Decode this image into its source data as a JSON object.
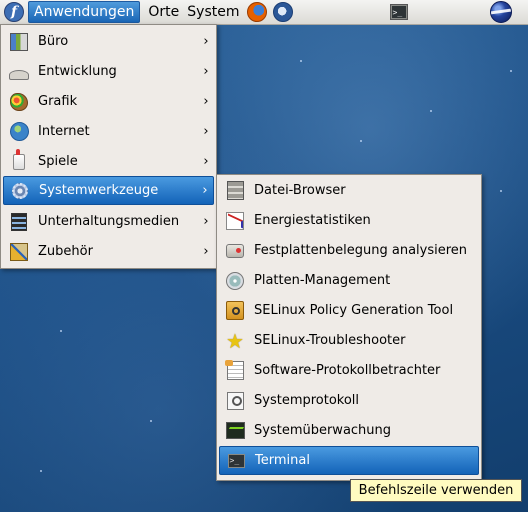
{
  "panel": {
    "menu_items": [
      {
        "label": "Anwendungen"
      },
      {
        "label": "Orte"
      },
      {
        "label": "System"
      }
    ],
    "fedora_glyph": "f"
  },
  "apps_menu": {
    "items": [
      {
        "label": "Büro",
        "icon": "office-icon"
      },
      {
        "label": "Entwicklung",
        "icon": "development-icon"
      },
      {
        "label": "Grafik",
        "icon": "graphics-icon"
      },
      {
        "label": "Internet",
        "icon": "internet-icon"
      },
      {
        "label": "Spiele",
        "icon": "games-icon"
      },
      {
        "label": "Systemwerkzeuge",
        "icon": "system-tools-icon",
        "selected": true
      },
      {
        "label": "Unterhaltungsmedien",
        "icon": "multimedia-icon"
      },
      {
        "label": "Zubehör",
        "icon": "accessories-icon"
      }
    ],
    "arrow_glyph": "›"
  },
  "system_tools_menu": {
    "items": [
      {
        "label": "Datei-Browser",
        "icon": "file-browser-icon"
      },
      {
        "label": "Energiestatistiken",
        "icon": "power-statistics-icon"
      },
      {
        "label": "Festplattenbelegung analysieren",
        "icon": "disk-usage-icon"
      },
      {
        "label": "Platten-Management",
        "icon": "disk-management-icon"
      },
      {
        "label": "SELinux Policy Generation Tool",
        "icon": "selinux-policy-icon"
      },
      {
        "label": "SELinux-Troubleshooter",
        "icon": "star-icon"
      },
      {
        "label": "Software-Protokollbetrachter",
        "icon": "log-viewer-icon"
      },
      {
        "label": "Systemprotokoll",
        "icon": "system-log-icon"
      },
      {
        "label": "Systemüberwachung",
        "icon": "system-monitor-icon"
      },
      {
        "label": "Terminal",
        "icon": "terminal-icon",
        "selected": true
      }
    ]
  },
  "tooltip": {
    "text": "Befehlszeile verwenden"
  },
  "colors": {
    "selection": "#1363b8",
    "menu_bg": "#efebe7",
    "tooltip_bg": "#fffbc0"
  }
}
